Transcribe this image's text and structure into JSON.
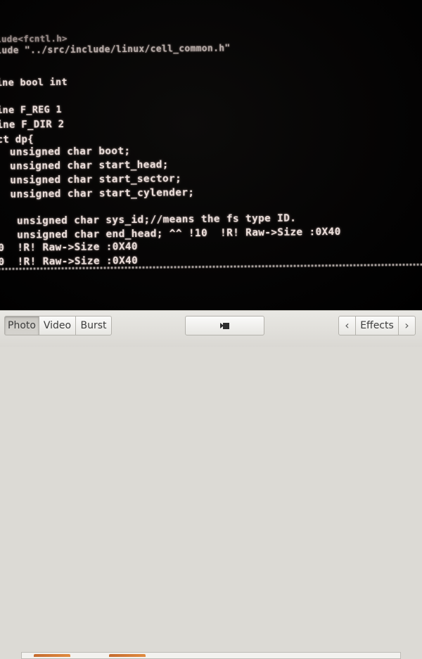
{
  "viewport": {
    "code_lines": [
      "lude<fcntl.h>",
      "lude \"../src/include/linux/cell_common.h\"",
      "ine bool int",
      "ine F_REG 1",
      "ine F_DIR 2",
      "ct dp{",
      "  unsigned char boot;",
      "  unsigned char start_head;",
      "  unsigned char start_sector;",
      "  unsigned char start_cylender;",
      "   unsigned char sys_id;//means the fs type ID.",
      "   unsigned char end_head; ^^ !10  !R! Raw->Size :0X40",
      "0  !R! Raw->Size :0X40",
      "0  !R! Raw->Size :0X40"
    ]
  },
  "toolbar": {
    "modes": [
      "Photo",
      "Video",
      "Burst"
    ],
    "active_mode": "Photo",
    "capture_icon": "camera-capture-icon",
    "prev_icon": "chevron-left-icon",
    "effects_label": "Effects",
    "next_icon": "chevron-right-icon",
    "prev_glyph": "‹",
    "next_glyph": "›"
  },
  "colors": {
    "terminal_text": "#ecdfdb",
    "terminal_bg": "#050404",
    "toolbar_bg": "#dcdad5",
    "thumbnail_accent": "#d97c38"
  }
}
